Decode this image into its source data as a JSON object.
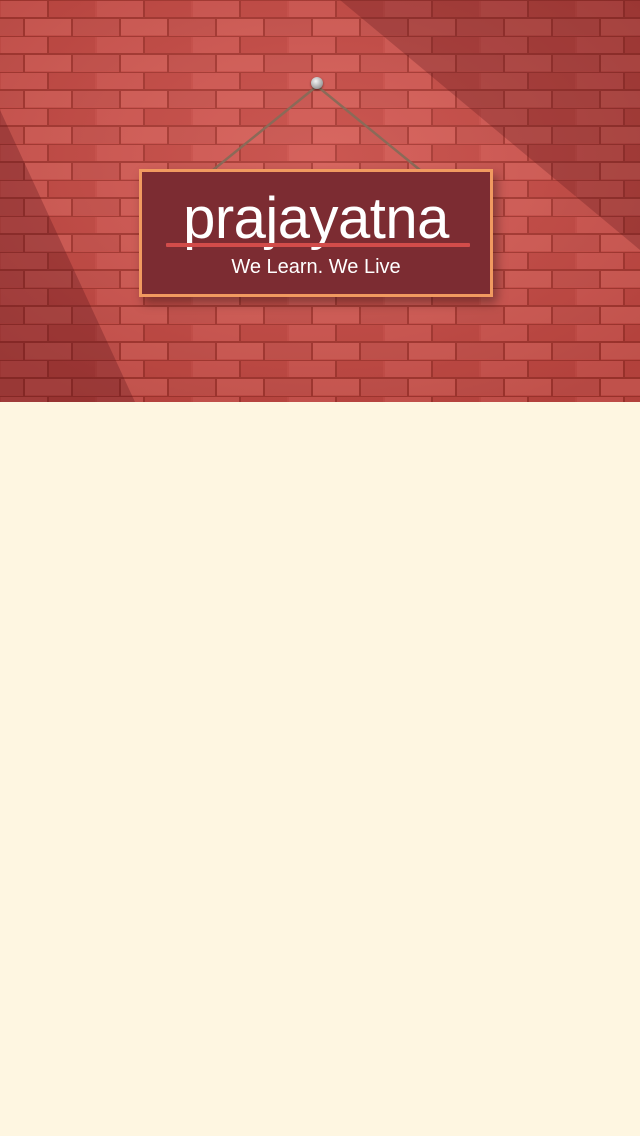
{
  "hero": {
    "title": "prajayatna",
    "tagline": "We Learn. We Live",
    "wall_color": "#c94a45",
    "sign_color": "#7c2c32",
    "sign_border_color": "#f19a60",
    "underline_color": "#d24c4a",
    "nail_icon": "nail-icon"
  },
  "content": {
    "background_color": "#fef6e1"
  }
}
